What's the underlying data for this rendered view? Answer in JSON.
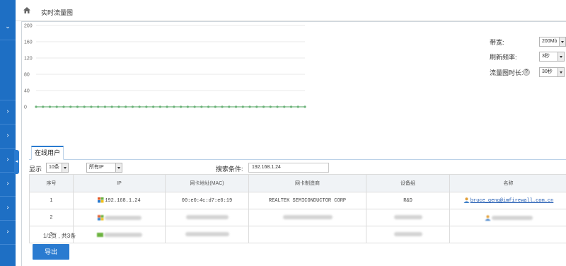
{
  "breadcrumb": {
    "title": "实时流量图"
  },
  "chart_data": {
    "type": "line",
    "title": "",
    "xlabel": "",
    "ylabel": "",
    "ylim": [
      0,
      200
    ],
    "y_ticks": [
      "200",
      "160",
      "120",
      "80",
      "40",
      "0"
    ],
    "series": [
      {
        "values": [
          0,
          0,
          0,
          0,
          0,
          0,
          0,
          0,
          0,
          0,
          0,
          0,
          0,
          0,
          0,
          0,
          0,
          0,
          0,
          0,
          0,
          0,
          0,
          0,
          0,
          0,
          0,
          0,
          0,
          0,
          0,
          0,
          0,
          0,
          0,
          0,
          0,
          0,
          0,
          0
        ],
        "color": "#6db37a"
      }
    ],
    "grid": true
  },
  "settings": {
    "bandwidth_label": "带宽:",
    "bandwidth_value": "200Mb",
    "refresh_label": "刷新频率:",
    "refresh_value": "3秒",
    "duration_label": "流量图时长:",
    "duration_value": "30秒",
    "help_symbol": "?"
  },
  "tab": {
    "label": "在线用户"
  },
  "filters": {
    "show_label": "显示",
    "page_size": "10条",
    "ip_filter": "所有IP",
    "search_label": "搜索条件:",
    "search_value": "192.168.1.24"
  },
  "table": {
    "headers": [
      "序号",
      "IP",
      "网卡地址(MAC)",
      "网卡制造商",
      "设备组",
      "名称"
    ],
    "rows": [
      {
        "index": "1",
        "ip": "192.168.1.24",
        "mac": "00:e0:4c:d7:e0:19",
        "vendor": "REALTEK SEMICONDUCTOR CORP",
        "group": "R&D",
        "name": "bruce_geng@imfirewall.com.cn"
      },
      {
        "index": "2"
      },
      {
        "index": "3"
      }
    ]
  },
  "pager": {
    "text": "1/1页 , 共3条"
  },
  "export": {
    "label": "导出"
  },
  "colors": {
    "accent": "#2a7bd0",
    "rail": "#1e6fc4",
    "series": "#6db37a"
  }
}
